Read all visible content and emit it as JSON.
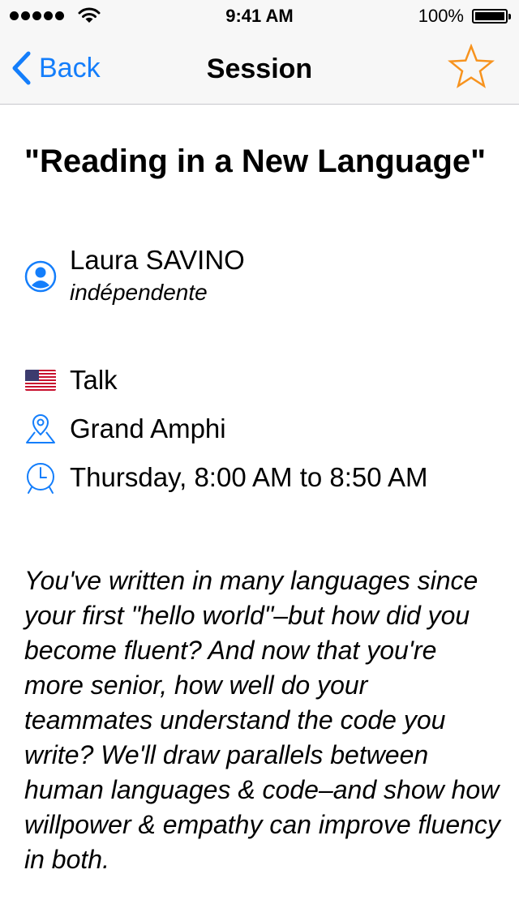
{
  "status_bar": {
    "time": "9:41 AM",
    "battery_percent": "100%",
    "signal_bars": 5,
    "wifi_icon": "wifi-icon",
    "battery_level": 1.0
  },
  "nav": {
    "back_label": "Back",
    "title": "Session",
    "back_icon": "chevron-left-icon",
    "favorite_icon": "star-outline-icon"
  },
  "session": {
    "title": "\"Reading in a New Language\"",
    "speaker": {
      "name": "Laura SAVINO",
      "company": "indépendente",
      "icon": "person-icon"
    },
    "type": {
      "label": "Talk",
      "icon": "us-flag-icon"
    },
    "room": {
      "label": "Grand Amphi",
      "icon": "location-pin-icon"
    },
    "time": {
      "label": "Thursday, 8:00 AM to 8:50 AM",
      "icon": "clock-icon"
    },
    "description": "You've written in many languages since your first \"hello world\"–but how did you become fluent? And now that you're more senior, how well do your teammates understand the code you write? We'll draw parallels between human languages & code–and show how willpower & empathy can improve fluency in both."
  },
  "colors": {
    "accent": "#147efb",
    "star": "#f7931e",
    "bar_background": "#f7f7f7"
  }
}
